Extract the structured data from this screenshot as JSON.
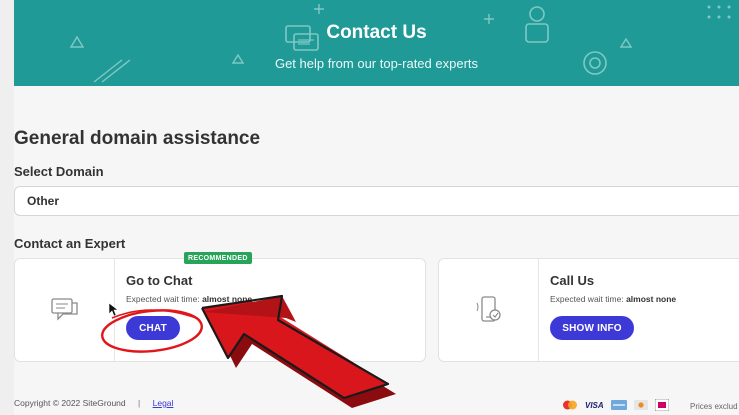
{
  "hero": {
    "title": "Contact Us",
    "subtitle": "Get help from our top-rated experts",
    "background": "#1f9a96"
  },
  "section": {
    "title": "General domain assistance"
  },
  "domain_select": {
    "label": "Select Domain",
    "value": "Other"
  },
  "experts": {
    "label": "Contact an Expert",
    "cards": [
      {
        "title": "Go to Chat",
        "badge": "RECOMMENDED",
        "wait_prefix": "Expected wait time:",
        "wait_value": "almost none",
        "button": "CHAT",
        "icon": "chat-icon"
      },
      {
        "title": "Call Us",
        "wait_prefix": "Expected wait time:",
        "wait_value": "almost none",
        "button": "SHOW INFO",
        "icon": "phone-icon"
      }
    ]
  },
  "footer": {
    "copyright": "Copyright © 2022 SiteGround",
    "separator": "|",
    "legal": "Legal",
    "payments": [
      "VISA"
    ],
    "prices_note": "Prices exclud"
  },
  "colors": {
    "accent": "#3c39d6",
    "badge": "#27a35a",
    "annotation": "#e0161b"
  }
}
